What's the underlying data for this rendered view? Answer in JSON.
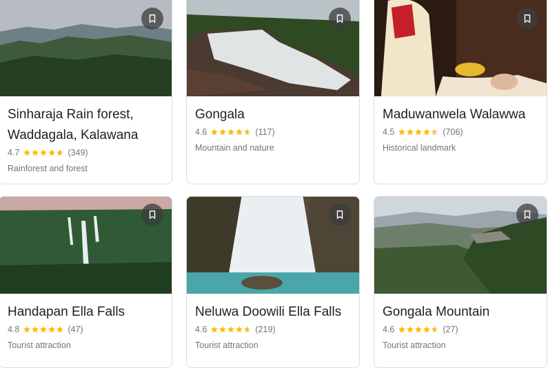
{
  "places": [
    {
      "name": "Sinharaja Rain forest,\nWaddagala, Kalawana",
      "rating": "4.7",
      "reviews": "(349)",
      "type": "Rainforest and forest",
      "stars": 4.7
    },
    {
      "name": "Gongala",
      "rating": "4.6",
      "reviews": "(117)",
      "type": "Mountain and nature",
      "stars": 4.6
    },
    {
      "name": "Maduwanwela Walawwa",
      "rating": "4.5",
      "reviews": "(706)",
      "type": "Historical landmark",
      "stars": 4.5
    },
    {
      "name": "Handapan Ella Falls",
      "rating": "4.8",
      "reviews": "(47)",
      "type": "Tourist attraction",
      "stars": 4.8
    },
    {
      "name": "Neluwa Doowili Ella Falls",
      "rating": "4.6",
      "reviews": "(219)",
      "type": "Tourist attraction",
      "stars": 4.6
    },
    {
      "name": "Gongala Mountain",
      "rating": "4.6",
      "reviews": "(27)",
      "type": "Tourist attraction",
      "stars": 4.6
    }
  ],
  "colors": {
    "star": "#fbbc04",
    "star_empty": "#dadce0",
    "text": "#202124",
    "muted": "#70757a"
  },
  "icons": {
    "save": "bookmark-icon",
    "star": "star-icon"
  }
}
